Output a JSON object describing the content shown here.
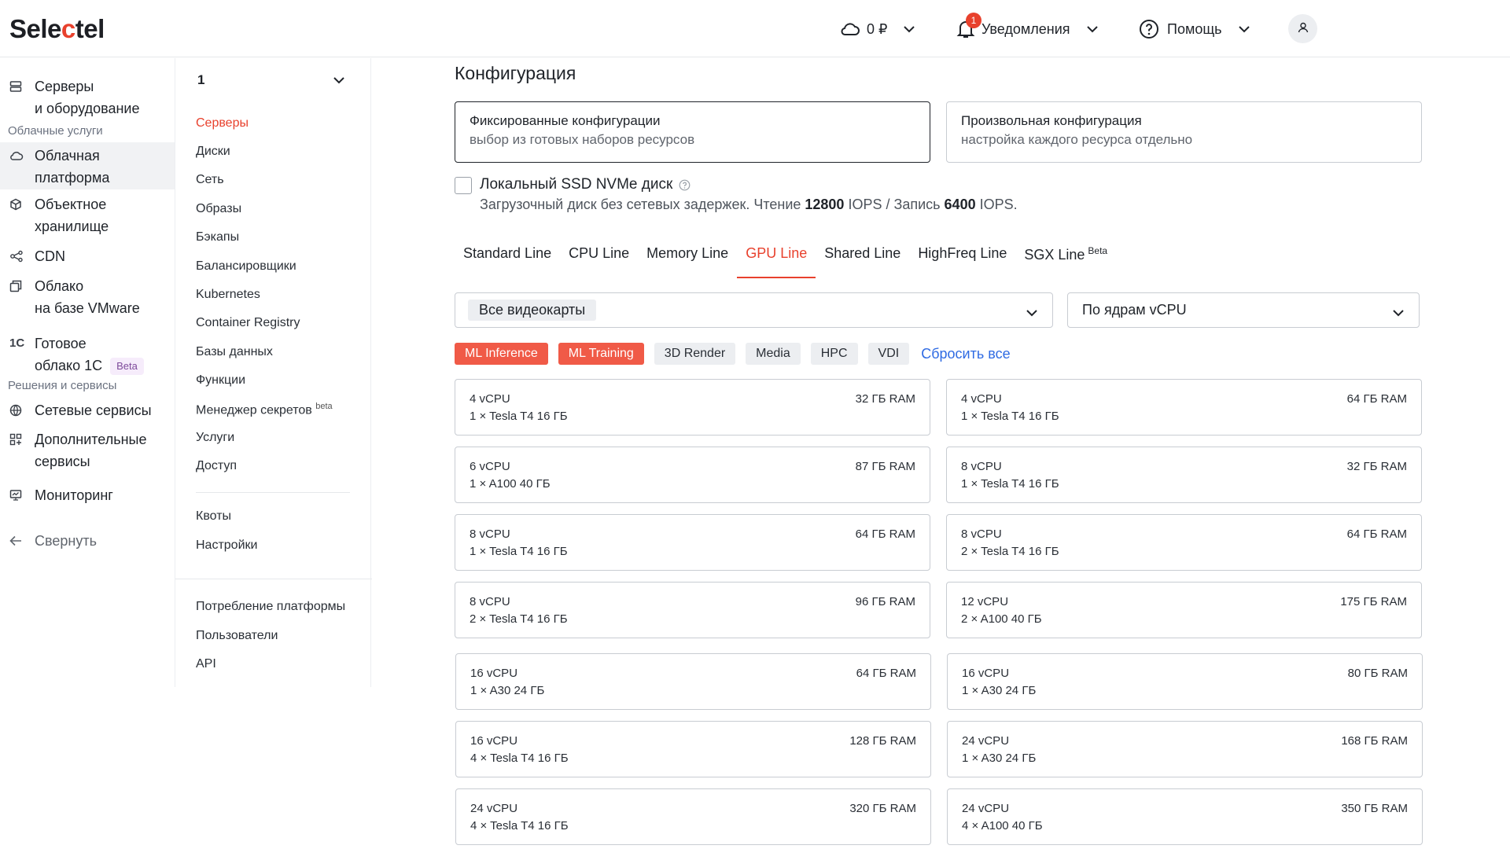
{
  "header": {
    "logo_prefix": "Sele",
    "logo_red": "c",
    "logo_suffix": "tel",
    "balance": "0 ₽",
    "notifications_label": "Уведомления",
    "notifications_count": "1",
    "help_label": "Помощь"
  },
  "sidebar": {
    "items": [
      {
        "label": "Серверы\nи оборудование",
        "icon": "servers-icon"
      },
      {
        "label": "Облачная\nплатформа",
        "icon": "cloud-icon"
      },
      {
        "label": "Объектное\nхранилище",
        "icon": "cube-icon"
      },
      {
        "label": "CDN",
        "icon": "cdn-icon"
      },
      {
        "label": "Облако\nна базе VMware",
        "icon": "vmware-icon"
      },
      {
        "label": "Готовое\nоблако 1С",
        "icon": "1c-icon"
      },
      {
        "label": "Сетевые сервисы",
        "icon": "globe-icon"
      },
      {
        "label": "Дополнительные\nсервисы",
        "icon": "apps-icon"
      },
      {
        "label": "Мониторинг",
        "icon": "monitor-icon"
      }
    ],
    "section_cloud": "Облачные услуги",
    "section_solutions": "Решения и сервисы",
    "beta": "Beta",
    "collapse_label": "Свернуть"
  },
  "panel": {
    "project": "1",
    "nav": [
      "Серверы",
      "Диски",
      "Сеть",
      "Образы",
      "Бэкапы",
      "Балансировщики",
      "Kubernetes",
      "Container Registry",
      "Базы данных",
      "Функции",
      "Менеджер секретов",
      "Услуги",
      "Доступ"
    ],
    "secrets_sup": "beta",
    "nav2": [
      "Квоты",
      "Настройки"
    ],
    "nav3": [
      "Потребление платформы",
      "Пользователи",
      "API"
    ]
  },
  "main": {
    "title": "Конфигурация",
    "fixed_title": "Фиксированные конфигурации",
    "fixed_sub": "выбор из готовых наборов ресурсов",
    "custom_title": "Произвольная конфигурация",
    "custom_sub": "настройка каждого ресурса отдельно",
    "local_ssd_label": "Локальный SSD NVMe диск",
    "local_ssd_desc_a": "Загрузочный диск без сетевых задержек. Чтение ",
    "local_ssd_read": "12800",
    "local_ssd_desc_b": " IOPS / Запись ",
    "local_ssd_write": "6400",
    "local_ssd_desc_c": " IOPS.",
    "tabs": [
      "Standard Line",
      "CPU Line",
      "Memory Line",
      "GPU Line",
      "Shared Line",
      "HighFreq Line",
      "SGX Line"
    ],
    "sgx_sup": "Beta",
    "gpu_filter": "Все видеокарты",
    "sort_filter": "По ядрам vCPU",
    "tags": [
      "ML Inference",
      "ML Training",
      "3D Render",
      "Media",
      "HPC",
      "VDI"
    ],
    "reset": "Сбросить все",
    "cards": [
      {
        "cpu": "4 vCPU",
        "gpu": "1 × Tesla T4  16 ГБ",
        "ram": "32 ГБ RAM"
      },
      {
        "cpu": "4 vCPU",
        "gpu": "1 × Tesla T4  16 ГБ",
        "ram": "64 ГБ RAM"
      },
      {
        "cpu": "6 vCPU",
        "gpu": "1 × A100  40 ГБ",
        "ram": "87 ГБ RAM"
      },
      {
        "cpu": "8 vCPU",
        "gpu": "1 × Tesla T4  16 ГБ",
        "ram": "32 ГБ RAM"
      },
      {
        "cpu": "8 vCPU",
        "gpu": "1 × Tesla T4  16 ГБ",
        "ram": "64 ГБ RAM"
      },
      {
        "cpu": "8 vCPU",
        "gpu": "2 × Tesla T4  16 ГБ",
        "ram": "64 ГБ RAM"
      },
      {
        "cpu": "8 vCPU",
        "gpu": "2 × Tesla T4  16 ГБ",
        "ram": "96 ГБ RAM"
      },
      {
        "cpu": "12 vCPU",
        "gpu": "2 × A100  40 ГБ",
        "ram": "175 ГБ RAM"
      },
      {
        "cpu": "16 vCPU",
        "gpu": "1 × A30  24 ГБ",
        "ram": "64 ГБ RAM"
      },
      {
        "cpu": "16 vCPU",
        "gpu": "1 × A30  24 ГБ",
        "ram": "80 ГБ RAM"
      },
      {
        "cpu": "16 vCPU",
        "gpu": "4 × Tesla T4  16 ГБ",
        "ram": "128 ГБ RAM"
      },
      {
        "cpu": "24 vCPU",
        "gpu": "1 × A30  24 ГБ",
        "ram": "168 ГБ RAM"
      },
      {
        "cpu": "24 vCPU",
        "gpu": "4 × Tesla T4  16 ГБ",
        "ram": "320 ГБ RAM"
      },
      {
        "cpu": "24 vCPU",
        "gpu": "4 × A100  40 ГБ",
        "ram": "350 ГБ RAM"
      }
    ]
  },
  "colors": {
    "accent": "#e8412d",
    "link": "#2f6be3"
  }
}
